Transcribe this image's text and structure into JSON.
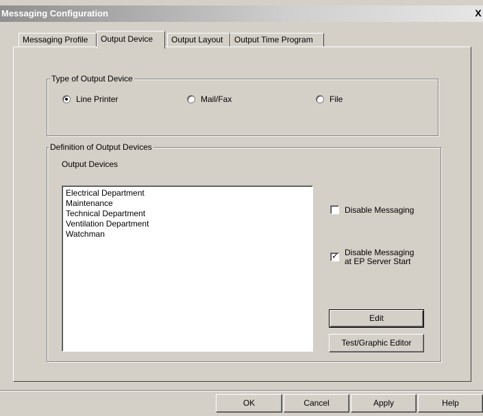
{
  "window": {
    "title": "Messaging Configuration",
    "close_glyph": "X"
  },
  "tabs": [
    {
      "label": "Messaging Profile",
      "active": false
    },
    {
      "label": "Output Device",
      "active": true
    },
    {
      "label": "Output Layout",
      "active": false
    },
    {
      "label": "Output Time Program",
      "active": false
    }
  ],
  "type_group": {
    "legend": "Type of Output Device",
    "options": [
      {
        "label": "Line Printer",
        "selected": true
      },
      {
        "label": "Mail/Fax",
        "selected": false
      },
      {
        "label": "File",
        "selected": false
      }
    ]
  },
  "definition_group": {
    "legend": "Definition of Output Devices",
    "list_label": "Output Devices",
    "list_items": [
      "Electrical Department",
      "Maintenance",
      "Technical Department",
      "Ventilation Department",
      "Watchman"
    ],
    "disable_messaging": {
      "label": "Disable Messaging",
      "checked": false
    },
    "disable_at_start": {
      "label_line1": "Disable Messaging",
      "label_line2": "at EP Server Start",
      "checked": true
    },
    "check_mark": "✓",
    "edit_label": "Edit",
    "test_editor_label": "Test/Graphic Editor"
  },
  "footer": {
    "ok_label": "OK",
    "cancel_label": "Cancel",
    "apply_label": "Apply",
    "help_label": "Help"
  }
}
